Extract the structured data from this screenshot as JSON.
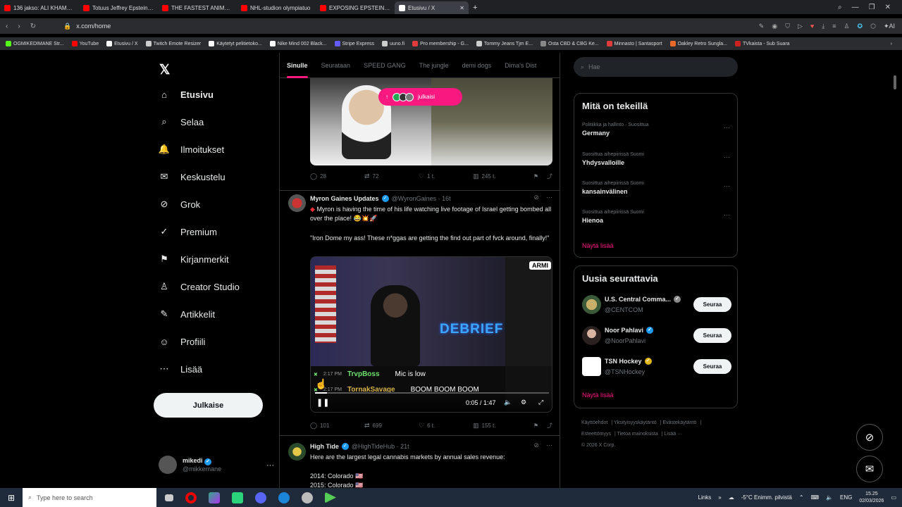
{
  "browser": {
    "tabs": [
      {
        "label": "136 jakso: ALI KHAMENEI",
        "color": "#ff0000"
      },
      {
        "label": "Totuus Jeffrey Epsteinin K",
        "color": "#ff0000"
      },
      {
        "label": "THE FASTEST ANIMATRON",
        "color": "#ff0000"
      },
      {
        "label": "NHL-studion olympiatuo",
        "color": "#ff0000"
      },
      {
        "label": "EXPOSING EPSTEIN'S ZOR",
        "color": "#ff0000"
      },
      {
        "label": "Etusivu / X",
        "color": "#ffffff"
      }
    ],
    "url": "x.com/home",
    "bookmarks": [
      {
        "label": "OGMIKEDIMANE Str...",
        "color": "#53fc18"
      },
      {
        "label": "YouTube",
        "color": "#ff0000"
      },
      {
        "label": "Etusivu / X",
        "color": "#ffffff"
      },
      {
        "label": "Twitch Emote Resizer",
        "color": "#cccccc"
      },
      {
        "label": "Käytetyt pelitietoko...",
        "color": "#ffffff"
      },
      {
        "label": "Nike Mind 002 Black...",
        "color": "#ffffff"
      },
      {
        "label": "Stripe Express",
        "color": "#635bff"
      },
      {
        "label": "uuno.fi",
        "color": "#cccccc"
      },
      {
        "label": "Pro membership - G...",
        "color": "#e23b3b"
      },
      {
        "label": "Tommy Jeans Tjm E...",
        "color": "#cccccc"
      },
      {
        "label": "Osta CBD & CBG Ke...",
        "color": "#888888"
      },
      {
        "label": "Minnasto | Santasport",
        "color": "#e23b3b"
      },
      {
        "label": "Oakley Retro Sungla...",
        "color": "#e86a2b"
      },
      {
        "label": "TVkaista - Sub Suara",
        "color": "#c22"
      }
    ]
  },
  "sidebar": {
    "logo": "𝕏",
    "items": [
      {
        "label": "Etusivu",
        "icon": "⌂",
        "active": true
      },
      {
        "label": "Selaa",
        "icon": "⌕"
      },
      {
        "label": "Ilmoitukset",
        "icon": "🔔"
      },
      {
        "label": "Keskustelu",
        "icon": "✉"
      },
      {
        "label": "Grok",
        "icon": "⊘"
      },
      {
        "label": "Premium",
        "icon": "✓"
      },
      {
        "label": "Kirjanmerkit",
        "icon": "⚑"
      },
      {
        "label": "Creator Studio",
        "icon": "♙"
      },
      {
        "label": "Artikkelit",
        "icon": "✎"
      },
      {
        "label": "Profiili",
        "icon": "☺"
      },
      {
        "label": "Lisää",
        "icon": "⋯"
      }
    ],
    "post_button": "Julkaise",
    "account": {
      "name": "mikedi",
      "handle": "@mikkemane"
    }
  },
  "feed": {
    "tabs": [
      "Sinulle",
      "Seurataan",
      "SPEED GANG",
      "The jungle",
      "demi dogs",
      "Dima's Dist"
    ],
    "new_posts_pill": "julkaisi",
    "tweet1_actions": {
      "replies": "28",
      "reposts": "72",
      "likes": "1 t.",
      "views": "245 t."
    },
    "tweet2": {
      "name": "Myron Gaines Updates",
      "handle": "@WyronGaines · 16t",
      "line1": "Myron is having the time of his life watching live footage of Israel getting bombed all over the place!",
      "line2": "\"Iron Dome my ass! These n*ggas are getting the find out part of fvck around, finally!\"",
      "video": {
        "overlay_text": "DEBRIEF",
        "corner_tag": "ARMI",
        "chat": [
          {
            "time": "2:17 PM",
            "user": "TrvpBoss",
            "msg": "Mic is low",
            "color": "#6ee06e"
          },
          {
            "time": "2:17 PM",
            "user": "TornakSavage",
            "msg": "BOOM BOOM BOOM",
            "color": "#d9b34a"
          }
        ],
        "time": "0:05 / 1:47",
        "progress": 0.05
      },
      "actions": {
        "replies": "101",
        "reposts": "699",
        "likes": "6 t.",
        "views": "155 t."
      }
    },
    "tweet3": {
      "name": "High Tide",
      "handle": "@HighTideHub · 21t",
      "line1": "Here are the largest legal cannabis markets by annual sales revenue:",
      "line2": "2014: Colorado",
      "line3": "2015: Colorado"
    }
  },
  "right": {
    "search_placeholder": "Hae",
    "trending": {
      "title": "Mitä on tekeillä",
      "items": [
        {
          "ctx": "Politiikka ja hallinto · Suosittua",
          "topic": "Germany"
        },
        {
          "ctx": "Suosittua aihepiirissä Suomi",
          "topic": "Yhdysvalloille"
        },
        {
          "ctx": "Suosittua aihepiirissä Suomi",
          "topic": "kansainvälinen"
        },
        {
          "ctx": "Suosittua aihepiirissä Suomi",
          "topic": "Hienoa"
        }
      ],
      "show_more": "Näytä lisää"
    },
    "who_to_follow": {
      "title": "Uusia seurattavia",
      "items": [
        {
          "name": "U.S. Central Comma...",
          "handle": "@CENTCOM",
          "badge": "grey",
          "button": "Seuraa"
        },
        {
          "name": "Noor Pahlavi",
          "handle": "@NoorPahlavi",
          "badge": "blue",
          "button": "Seuraa"
        },
        {
          "name": "TSN Hockey",
          "handle": "@TSNHockey",
          "badge": "gold",
          "button": "Seuraa"
        }
      ],
      "show_more": "Näytä lisää"
    },
    "footer": [
      "Käyttöehdot",
      "Yksityisyyskäytäntö",
      "Evästekäytäntö",
      "Esteettömyys",
      "Tietoa mainoksista",
      "Lisää ···",
      "© 2026 X Corp."
    ]
  },
  "taskbar": {
    "search_placeholder": "Type here to search",
    "links": "Links",
    "weather": "-5°C  Enimm. pilvistä",
    "lang": "ENG",
    "time": "15.25",
    "date": "02/03/2026"
  }
}
